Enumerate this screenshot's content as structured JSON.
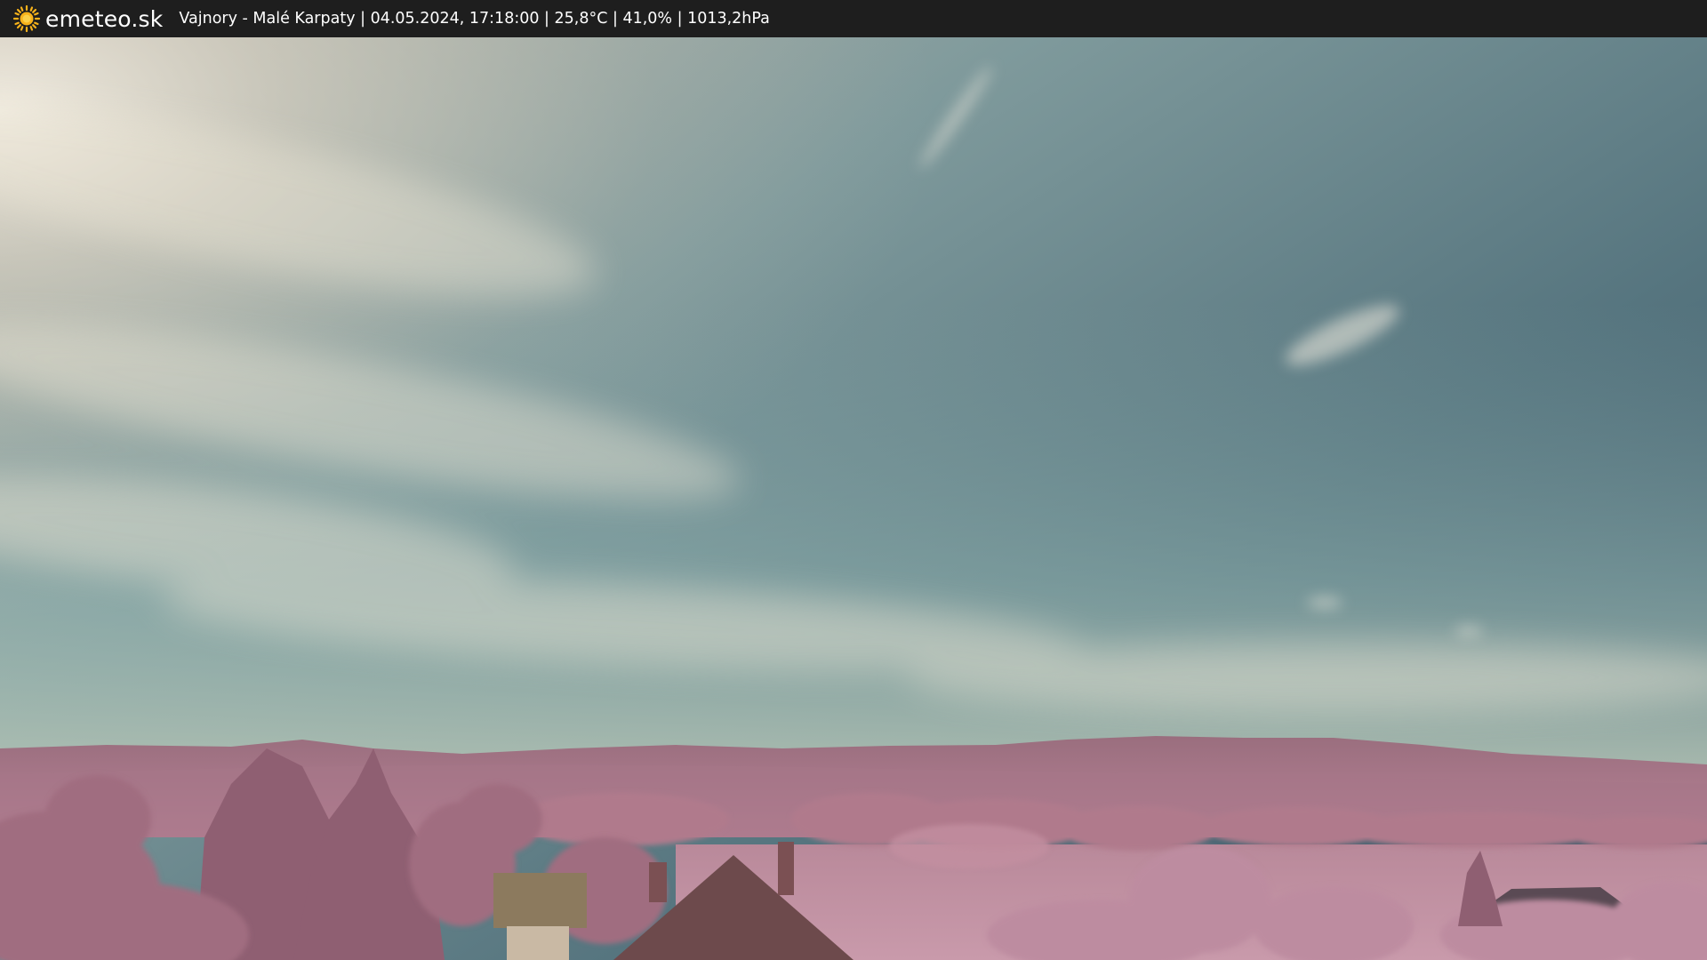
{
  "header": {
    "brand": "emeteo.sk",
    "brand_icon": "sun-icon",
    "caption": "Vajnory - Malé Karpaty | 04.05.2024, 17:18:00 | 25,8°C | 41,0% | 1013,2hPa"
  },
  "colors": {
    "bar_background": "#1e1e1e",
    "sun_icon": "#f7b21a",
    "sky_upper": "#4e6f7e",
    "sky_haze": "#e3dccb",
    "vegetation": "#b07a8c"
  }
}
